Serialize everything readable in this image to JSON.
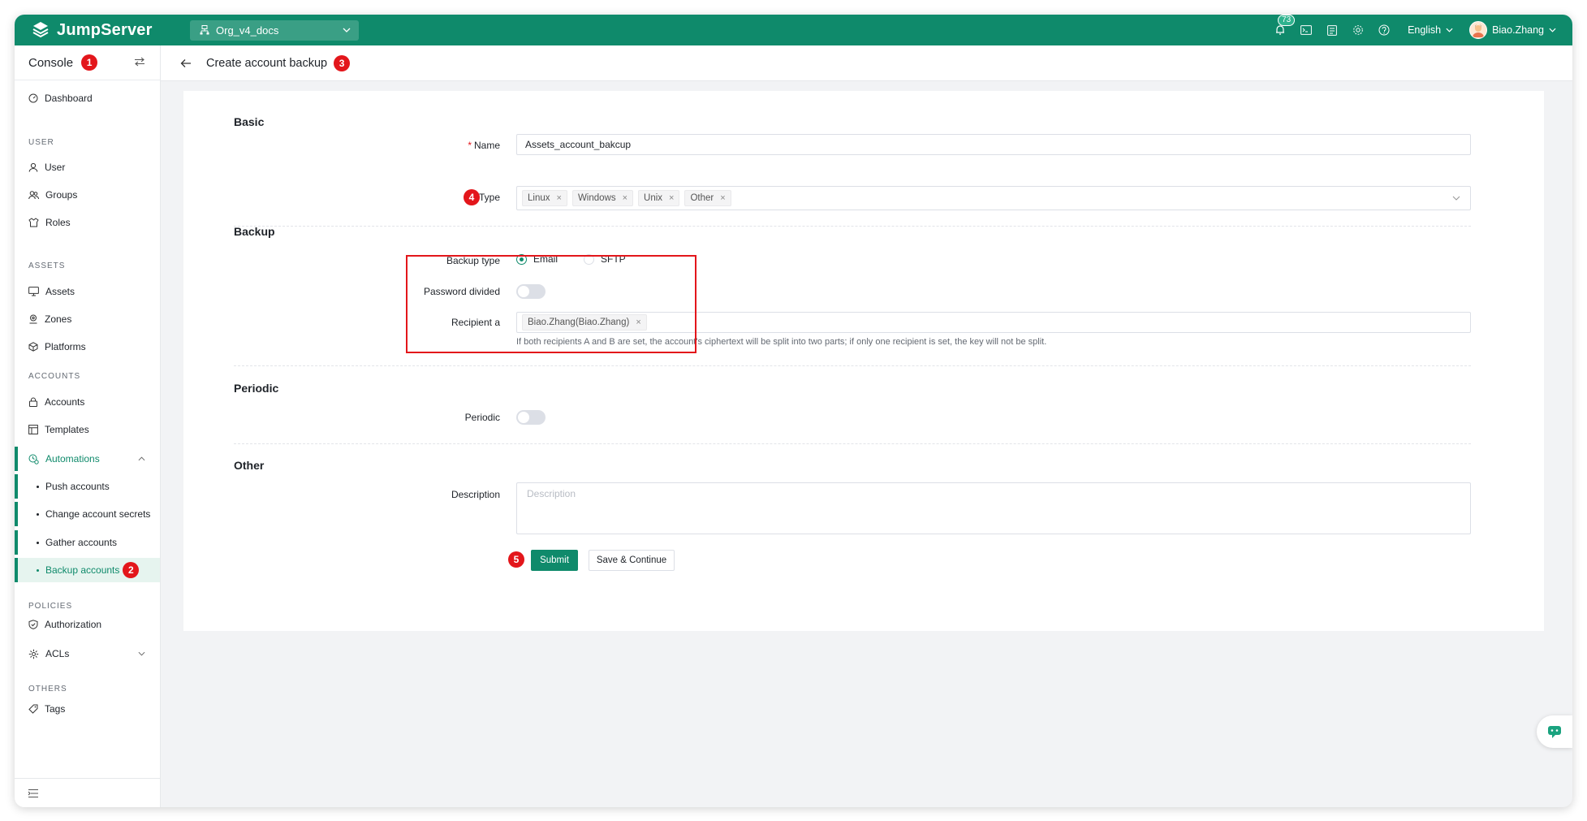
{
  "topbar": {
    "brand": "JumpServer",
    "org": "Org_v4_docs",
    "notifications_count": "73",
    "language": "English",
    "username": "Biao.Zhang"
  },
  "sidebar": {
    "title": "Console",
    "items": {
      "dashboard": "Dashboard",
      "user_section": "USER",
      "user": "User",
      "groups": "Groups",
      "roles": "Roles",
      "assets_section": "ASSETS",
      "assets": "Assets",
      "zones": "Zones",
      "platforms": "Platforms",
      "accounts_section": "ACCOUNTS",
      "accounts": "Accounts",
      "templates": "Templates",
      "automations": "Automations",
      "push_accounts": "Push accounts",
      "change_secrets": "Change account secrets",
      "gather_accounts": "Gather accounts",
      "backup_accounts": "Backup accounts",
      "policies_section": "POLICIES",
      "authorization": "Authorization",
      "acls": "ACLs",
      "others_section": "OTHERS",
      "tags": "Tags"
    }
  },
  "page": {
    "title": "Create account backup"
  },
  "steps": {
    "one": "1",
    "two": "2",
    "three": "3",
    "four": "4",
    "five": "5"
  },
  "form": {
    "basic": {
      "heading": "Basic",
      "name_label": "Name",
      "name_required_mark": "*",
      "name_value": "Assets_account_bakcup",
      "type_label": "Type",
      "type_tags": [
        "Linux",
        "Windows",
        "Unix",
        "Other"
      ]
    },
    "backup": {
      "heading": "Backup",
      "backup_type_label": "Backup type",
      "option_email": "Email",
      "option_sftp": "SFTP",
      "selected": "Email",
      "password_divided_label": "Password divided",
      "password_divided": false,
      "recipient_label": "Recipient a",
      "recipient_tag": "Biao.Zhang(Biao.Zhang)",
      "hint": "If both recipients A and B are set, the account's ciphertext will be split into two parts; if only one recipient is set, the key will not be split."
    },
    "periodic": {
      "heading": "Periodic",
      "periodic_label": "Periodic",
      "periodic": false
    },
    "other": {
      "heading": "Other",
      "description_label": "Description",
      "description_placeholder": "Description"
    },
    "actions": {
      "submit": "Submit",
      "save_continue": "Save & Continue"
    }
  },
  "colors": {
    "brand": "#0f8a6b",
    "marker_red": "#e3161b",
    "active_bg": "#e6f4ef"
  }
}
